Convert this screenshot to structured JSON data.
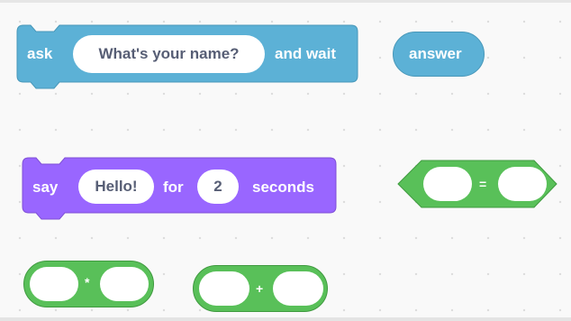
{
  "colors": {
    "sensing": "#5cb1d6",
    "sensing_dark": "#4797b9",
    "looks": "#9966ff",
    "looks_dark": "#7f4fd6",
    "operators": "#59c059",
    "operators_dark": "#3f9a3f",
    "slot_text": "#575e75",
    "background": "#f9f9f9"
  },
  "ask_block": {
    "label_ask": "ask",
    "input_value": "What's your name?",
    "label_and_wait": "and wait"
  },
  "answer_block": {
    "label": "answer"
  },
  "say_block": {
    "label_say": "say",
    "message_value": "Hello!",
    "label_for": "for",
    "seconds_value": "2",
    "label_seconds": "seconds"
  },
  "equals_block": {
    "operator": "=",
    "left_value": "",
    "right_value": ""
  },
  "multiply_block": {
    "operator": "*",
    "left_value": "",
    "right_value": ""
  },
  "add_block": {
    "operator": "+",
    "left_value": "",
    "right_value": ""
  }
}
